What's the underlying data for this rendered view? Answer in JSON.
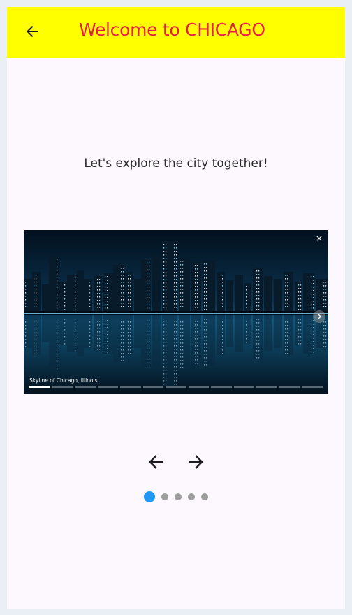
{
  "appbar": {
    "title": "Welcome to CHICAGO",
    "back_icon": "arrow-left-icon",
    "background_color": "#ffff00",
    "title_color": "#e91e50"
  },
  "main": {
    "subtitle": "Let's explore the city together!"
  },
  "photo": {
    "caption": "Skyline of Chicago, Illinois",
    "close_icon": "close-icon",
    "next_icon": "chevron-right-icon",
    "slide_count": 13,
    "active_slide": 1
  },
  "navigation": {
    "prev_icon": "arrow-left-icon",
    "next_icon": "arrow-right-icon"
  },
  "pager": {
    "count": 5,
    "active_index": 0,
    "active_color": "#2196f3",
    "inactive_color": "#9e9e9e"
  }
}
